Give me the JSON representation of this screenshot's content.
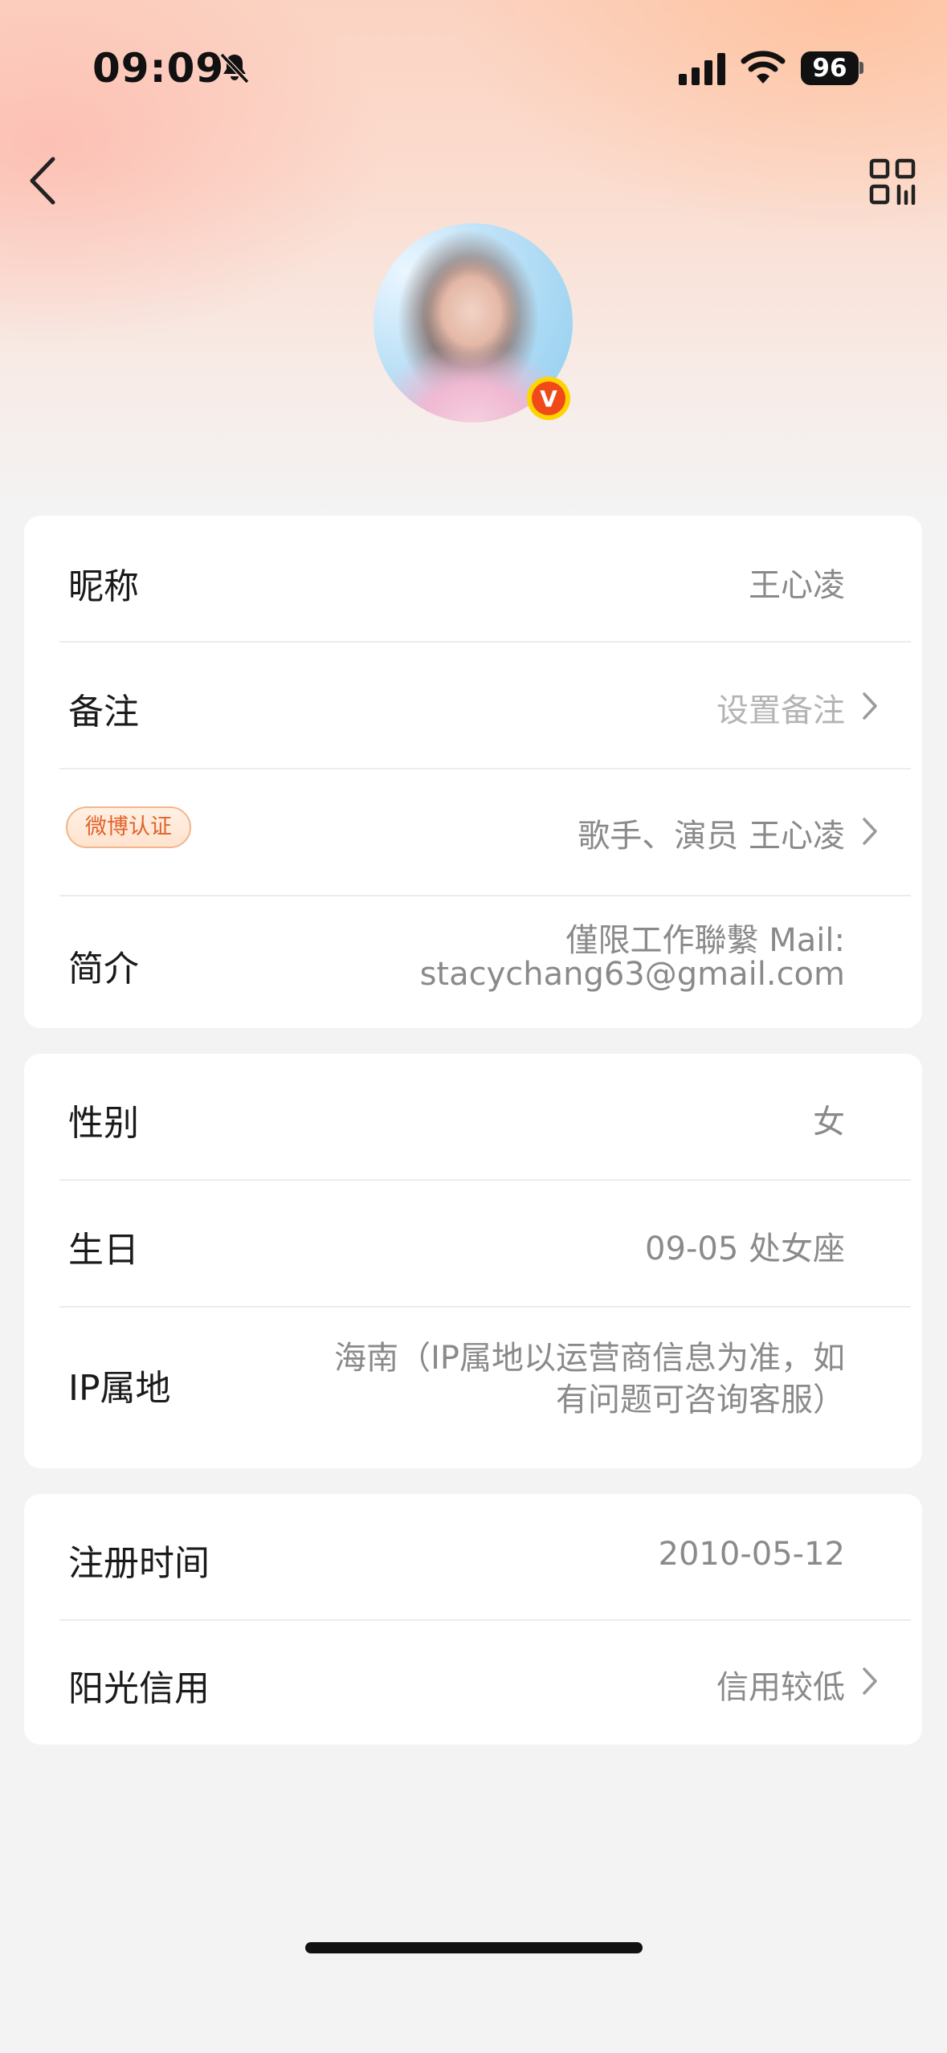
{
  "status_bar": {
    "time": "09:09",
    "battery": "96"
  },
  "profile": {
    "verified_badge_letter": "V"
  },
  "card1": {
    "nickname_label": "昵称",
    "nickname_value": "王心凌",
    "remark_label": "备注",
    "remark_value": "设置备注",
    "weibo_badge": "微博认证",
    "weibo_value": "歌手、演员 王心凌",
    "bio_label": "简介",
    "bio_line1": "僅限工作聯繫 Mail:",
    "bio_line2": "stacychang63@gmail.com"
  },
  "card2": {
    "gender_label": "性别",
    "gender_value": "女",
    "birthday_label": "生日",
    "birthday_value": "09-05 处女座",
    "ip_label": "IP属地",
    "ip_line1": "海南（IP属地以运营商信息为准，如",
    "ip_line2": "有问题可咨询客服）"
  },
  "card3": {
    "register_label": "注册时间",
    "register_value": "2010-05-12",
    "credit_label": "阳光信用",
    "credit_value": "信用较低"
  },
  "colors": {
    "accent_orange": "#e2632a",
    "badge_border": "#f3b58a",
    "verified_yellow": "#ffd400",
    "verified_red": "#f04a1a"
  }
}
